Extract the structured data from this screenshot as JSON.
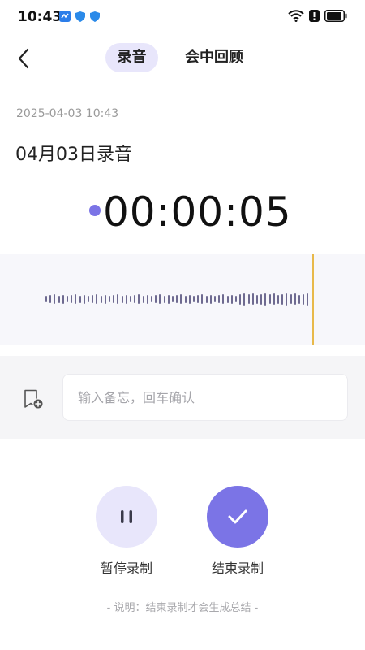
{
  "status": {
    "time": "10:43"
  },
  "header": {
    "tabs": [
      {
        "label": "录音",
        "active": true
      },
      {
        "label": "会中回顾",
        "active": false
      }
    ]
  },
  "recording": {
    "datetime": "2025-04-03 10:43",
    "title": "04月03日录音",
    "elapsed": "00:00:05"
  },
  "memo": {
    "placeholder": "输入备忘，回车确认",
    "value": ""
  },
  "controls": {
    "pause_label": "暂停录制",
    "finish_label": "结束录制"
  },
  "footer_note": "- 说明：结束录制才会生成总结 -",
  "colors": {
    "accent": "#7b74e6",
    "accent_light": "#e8e6fb",
    "playhead": "#e8b94a"
  }
}
